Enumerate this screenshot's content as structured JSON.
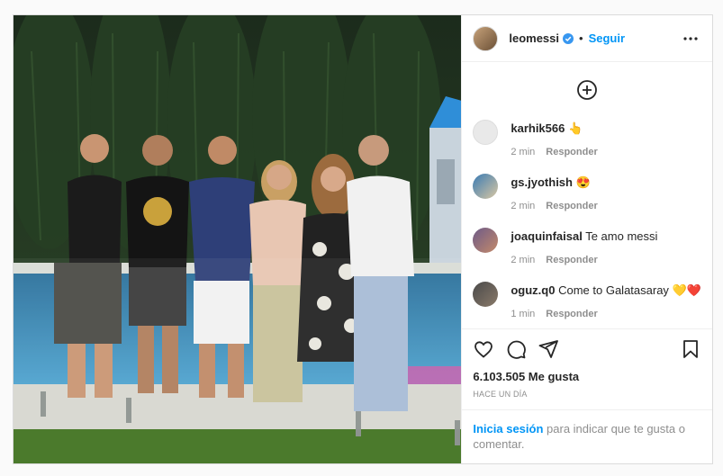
{
  "post": {
    "author": "leomessi",
    "follow_label": "Seguir",
    "dot": "•",
    "likes": "6.103.505 Me gusta",
    "time_ago": "HACE UN DÍA",
    "login_link": "Inicia sesión",
    "login_rest": "para indicar que te gusta o comentar."
  },
  "comments": [
    {
      "user": "karhik566",
      "text": "👆",
      "time": "2 min",
      "reply": "Responder",
      "avatar_color": "#e9e9e9"
    },
    {
      "user": "gs.jyothish",
      "text": "😍",
      "time": "2 min",
      "reply": "Responder",
      "avatar_color": "#3a7bb3"
    },
    {
      "user": "joaquinfaisal",
      "text": "Te amo messi",
      "time": "2 min",
      "reply": "Responder",
      "avatar_color": "#6d5a88"
    },
    {
      "user": "oguz.q0",
      "text": "Come to Galatasaray 💛❤️",
      "time": "1 min",
      "reply": "Responder",
      "avatar_color": "#4a4a4a"
    }
  ]
}
